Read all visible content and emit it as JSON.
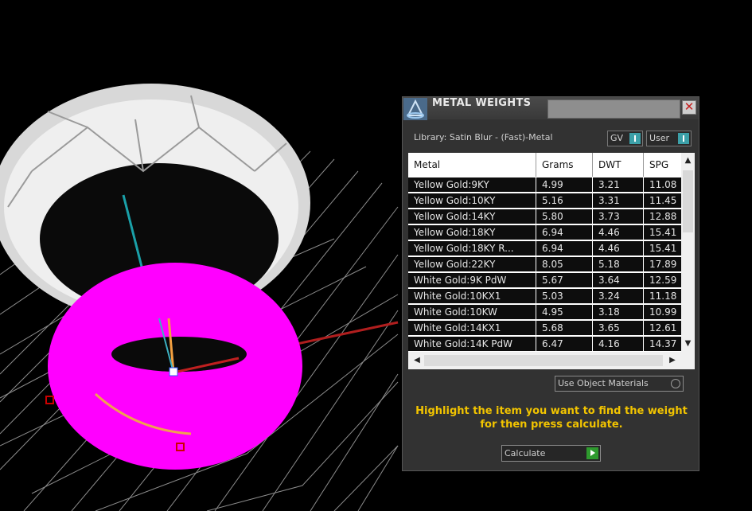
{
  "window": {
    "title": "METAL WEIGHTS",
    "library_label": "Library: Satin Blur - (Fast)-Metal",
    "toggle_gv": "GV",
    "toggle_user": "User"
  },
  "table": {
    "columns": [
      "Metal",
      "Grams",
      "DWT",
      "SPG"
    ],
    "rows": [
      [
        "Yellow Gold:9KY",
        "4.99",
        "3.21",
        "11.08"
      ],
      [
        "Yellow Gold:10KY",
        "5.16",
        "3.31",
        "11.45"
      ],
      [
        "Yellow Gold:14KY",
        "5.80",
        "3.73",
        "12.88"
      ],
      [
        "Yellow Gold:18KY",
        "6.94",
        "4.46",
        "15.41"
      ],
      [
        "Yellow Gold:18KY R...",
        "6.94",
        "4.46",
        "15.41"
      ],
      [
        "Yellow Gold:22KY",
        "8.05",
        "5.18",
        "17.89"
      ],
      [
        "White Gold:9K PdW",
        "5.67",
        "3.64",
        "12.59"
      ],
      [
        "White Gold:10KX1",
        "5.03",
        "3.24",
        "11.18"
      ],
      [
        "White Gold:10KW",
        "4.95",
        "3.18",
        "10.99"
      ],
      [
        "White Gold:14KX1",
        "5.68",
        "3.65",
        "12.61"
      ],
      [
        "White Gold:14K PdW",
        "6.47",
        "4.16",
        "14.37"
      ]
    ]
  },
  "use_object_materials": "Use Object Materials",
  "hint": "Highlight the item you want to find the weight for then press calculate.",
  "calculate_label": "Calculate",
  "colors": {
    "panel": "#323232",
    "hint": "#f2c400",
    "selection": "#ff00ff",
    "accent": "#3ca0a8"
  }
}
